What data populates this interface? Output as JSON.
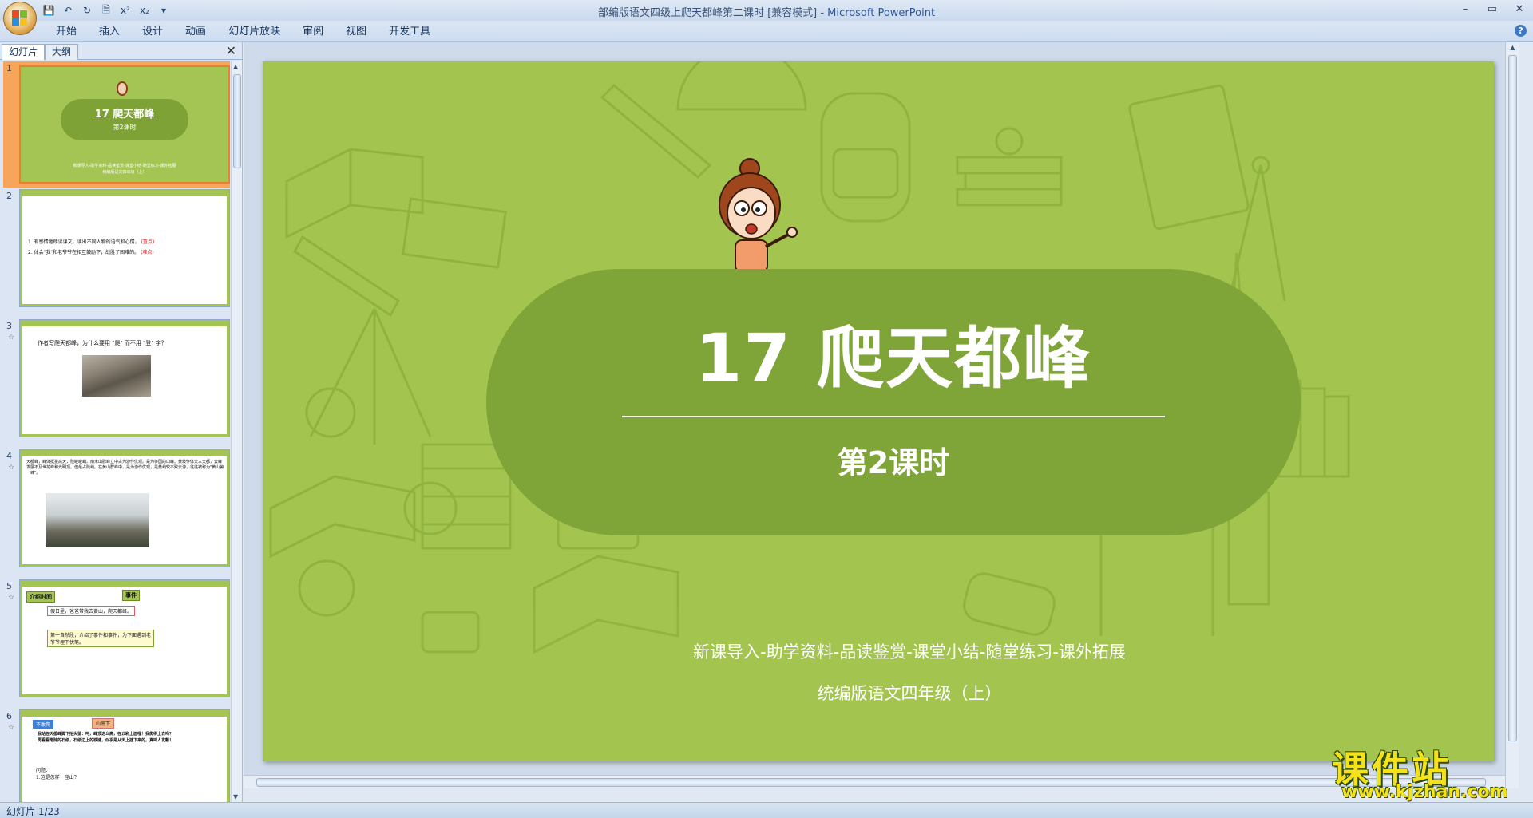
{
  "window": {
    "title": "部编版语文四级上爬天都峰第二课时 [兼容模式] - ",
    "app_name": "Microsoft PowerPoint",
    "minimize": "–",
    "maximize": "▭",
    "close": "✕"
  },
  "quick_access": {
    "save": "💾",
    "undo": "↶",
    "redo": "↻",
    "print_preview": "🗎",
    "superscript": "x²",
    "subscript": "x₂",
    "more": "▾"
  },
  "ribbon": {
    "tabs": [
      "开始",
      "插入",
      "设计",
      "动画",
      "幻灯片放映",
      "审阅",
      "视图",
      "开发工具"
    ],
    "help": "?"
  },
  "panel": {
    "tab_slides": "幻灯片",
    "tab_outline": "大纲",
    "close": "✕"
  },
  "thumbnails": [
    {
      "num": "1",
      "title": "17 爬天都峰",
      "lesson": "第2课时"
    },
    {
      "num": "2",
      "line1": "1. 有感情地朗读课文，读出不同人物的语气和心情。",
      "tag1": "(重点)",
      "line2": "2. 体会\"我\"和老爷爷在相互鼓励下，战胜了困难的。",
      "tag2": "(难点)"
    },
    {
      "num": "3",
      "question": "作者写爬天都峰，为什么要用 \"爬\" 而不用 \"登\" 字？"
    },
    {
      "num": "4",
      "para": "天都峰，峰体挺拔高天，险峻峻峭。南宋山脉峰立中占为游作优观。是为争因的山峰。黄坡作体大三天都，去峰发展不及世花峰和光明顶。但最占陡峭。在黄山群峰中，是为游作优观，是黄峭较不致去游，往往被称为\"黄山第一峰\"。"
    },
    {
      "num": "5",
      "tag_a": "介绍时间",
      "tag_b": "事件",
      "box1": "假日里，爸爸带我去黄山，爬天都峰。",
      "box2": "第一自然段，介绍了事件和事件，为下面遇到老爷爷埋下伏笔。"
    },
    {
      "num": "6",
      "tag_a": "不敢爬",
      "tag_b": "山底下",
      "text": "我站在天都峰脚下抬头望：呵，峰顶这么高，在云彩上面哩！我爬得上去吗？再看看笔陡的石级，石级边上的铁链，似乎是从天上挂下来的，真叫人发颤！",
      "q_label": "问题：",
      "q1": "1.这是怎样一座山？"
    }
  ],
  "slide": {
    "title": "17 爬天都峰",
    "lesson": "第2课时",
    "sections": "新课导入-助学资料-品读鉴赏-课堂小结-随堂练习-课外拓展",
    "edition": "统编版语文四年级（上）",
    "colors": {
      "background": "#a3c550",
      "pill": "#7fa437",
      "text": "#ffffff"
    }
  },
  "status": {
    "slide_counter": "幻灯片 1/23"
  },
  "watermark": {
    "name": "课件站",
    "url": "www.kjzhan.com"
  }
}
